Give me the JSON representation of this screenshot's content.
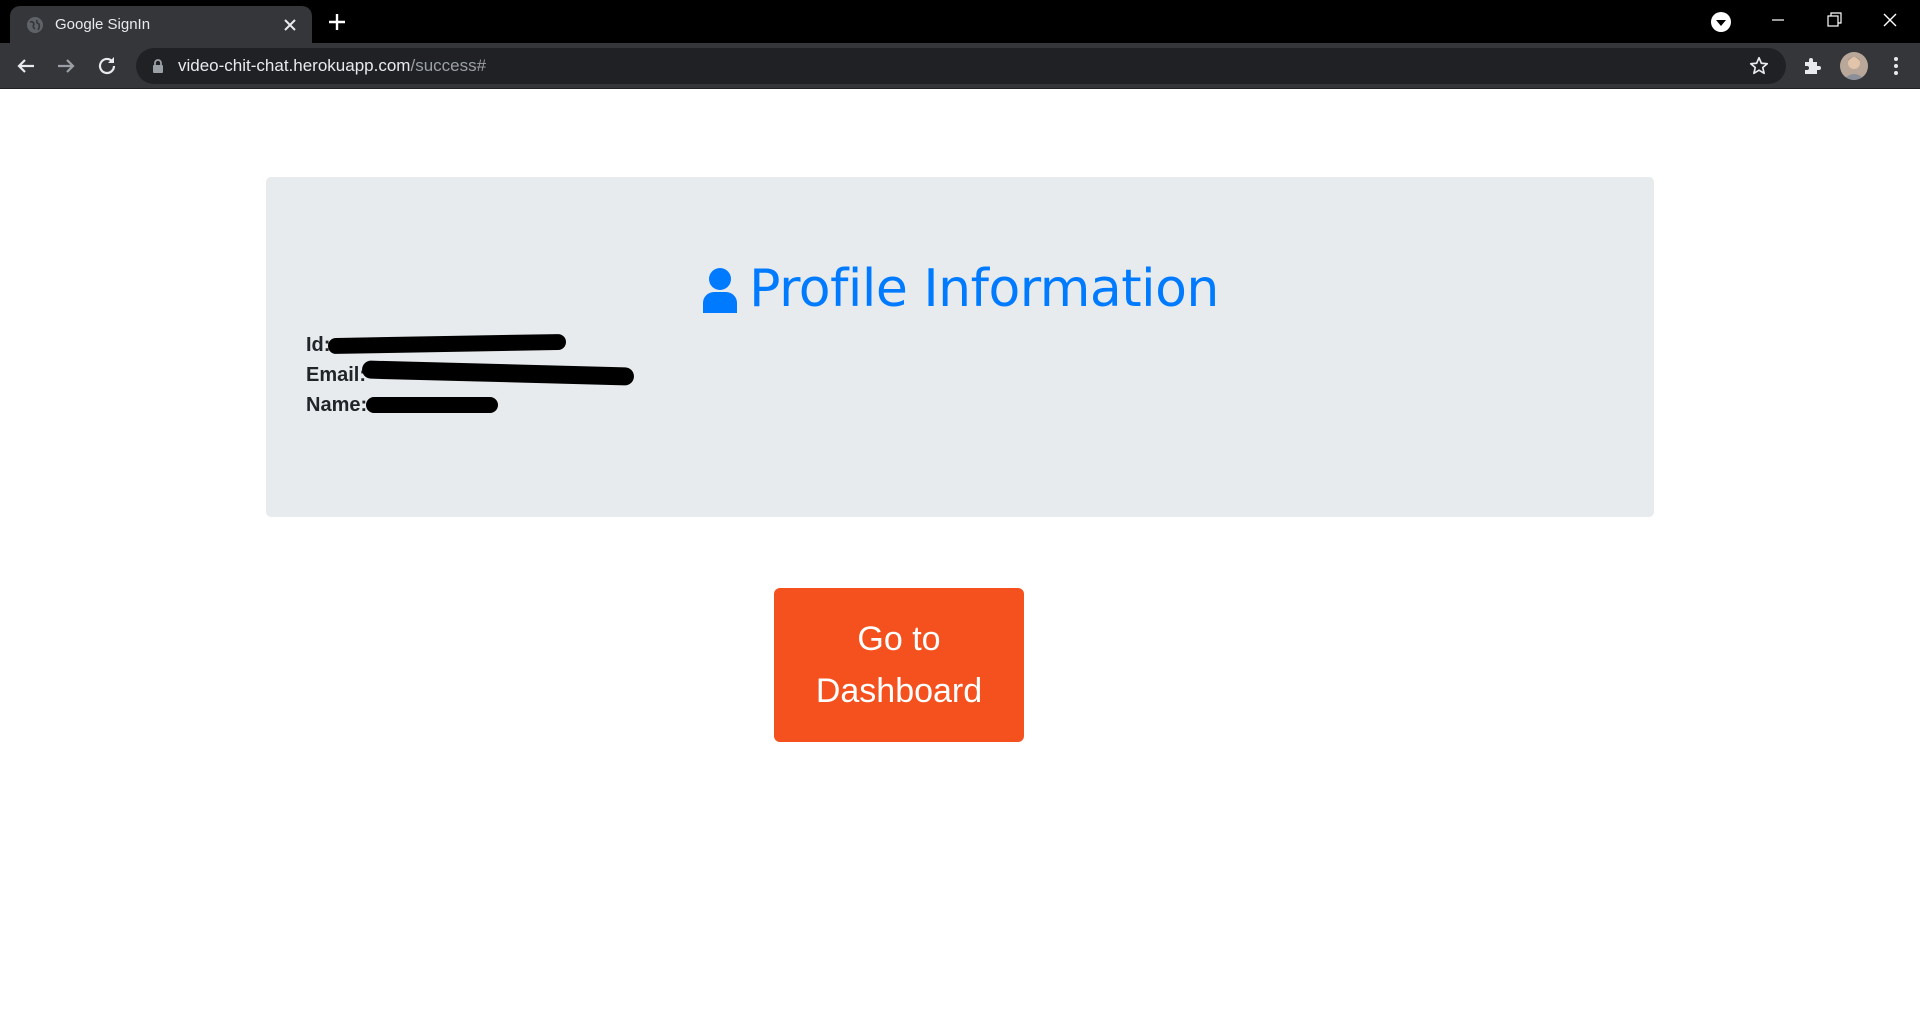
{
  "browser": {
    "tab_title": "Google SignIn",
    "url_host": "video-chit-chat.herokuapp.com",
    "url_path": "/success#",
    "icons": {
      "tab_favicon": "globe-icon",
      "tab_close": "close-icon",
      "new_tab": "plus-icon",
      "media": "media-control-icon",
      "minimize": "minimize-icon",
      "maximize": "restore-icon",
      "window_close": "close-icon",
      "back": "arrow-left-icon",
      "forward": "arrow-right-icon",
      "reload": "reload-icon",
      "lock": "lock-icon",
      "bookmark": "star-icon",
      "extensions": "puzzle-icon",
      "menu": "kebab-menu-icon"
    }
  },
  "profile": {
    "heading": "Profile Information",
    "heading_icon": "user-icon",
    "fields": [
      {
        "label": "Id:",
        "value": ""
      },
      {
        "label": "Email:",
        "value": ""
      },
      {
        "label": "Name:",
        "value": ""
      }
    ]
  },
  "actions": {
    "dashboard_label": "Go to Dashboard"
  },
  "colors": {
    "accent": "#007bff",
    "button": "#f4511e",
    "card_bg": "#e8ebee"
  }
}
